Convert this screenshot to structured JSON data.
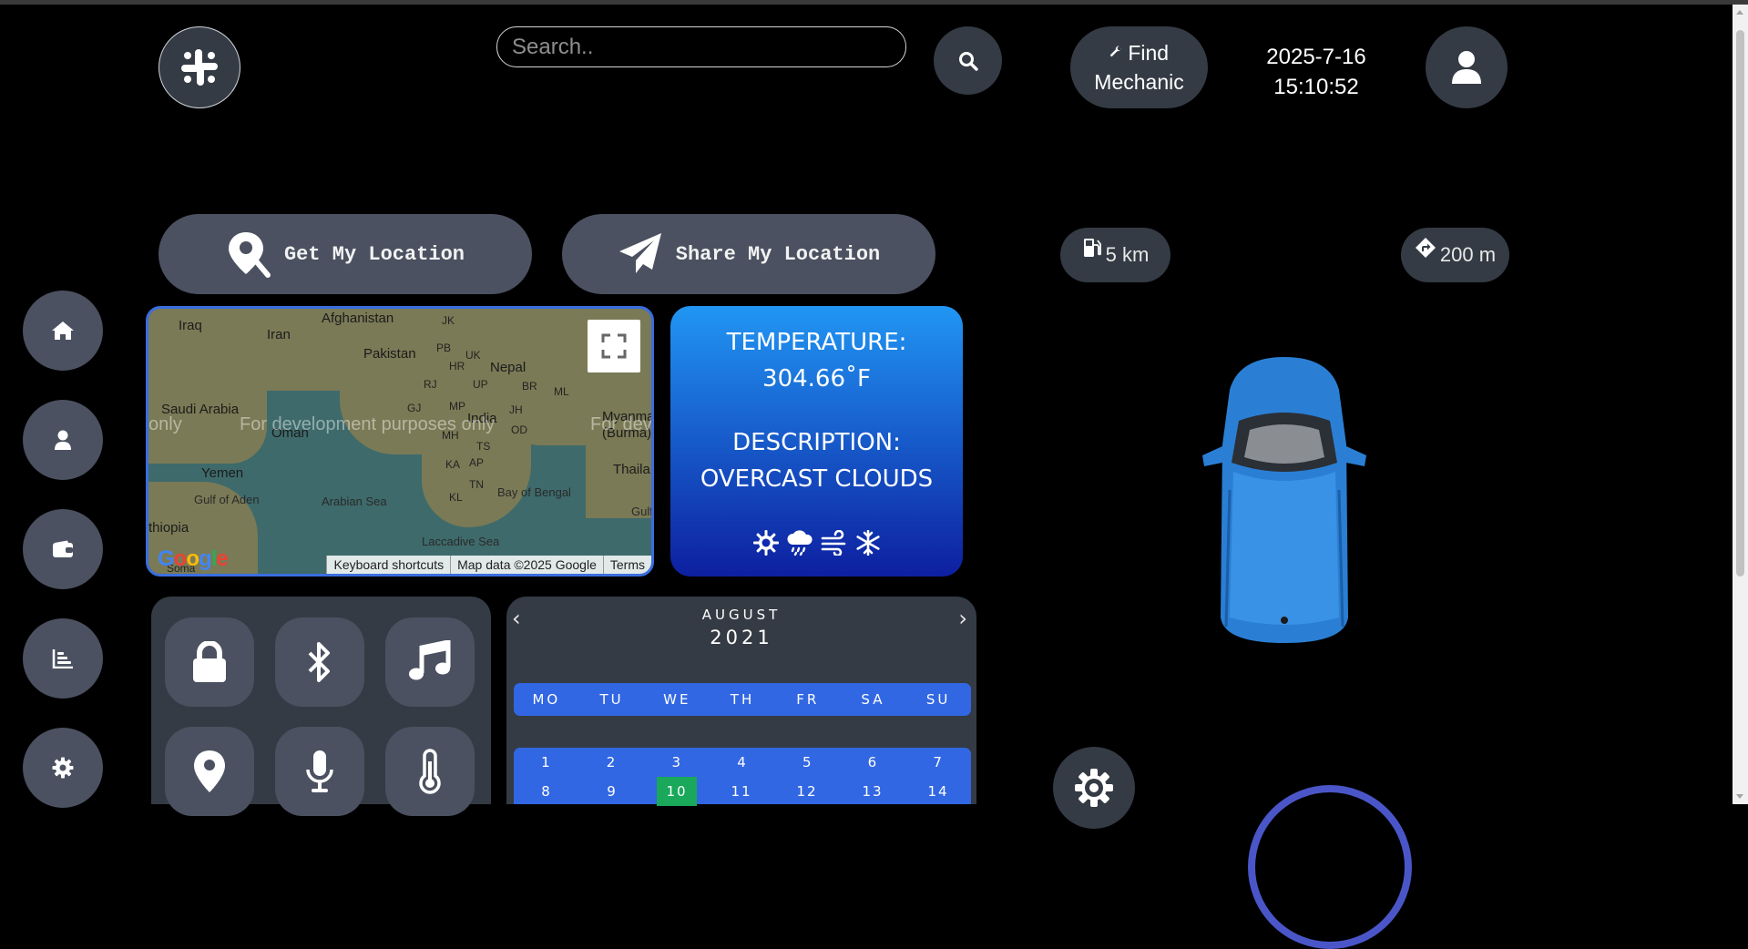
{
  "header": {
    "search_placeholder": "Search..",
    "find_mechanic_line1": "Find",
    "find_mechanic_line2": "Mechanic",
    "date": "2025-7-16",
    "time": "15:10:52"
  },
  "actions": {
    "get_location": "Get My Location",
    "share_location": "Share My Location"
  },
  "stats": {
    "fuel_range": "5 km",
    "next_turn": "200 m"
  },
  "sidebar": {
    "items": [
      {
        "icon": "home-icon"
      },
      {
        "icon": "user-icon"
      },
      {
        "icon": "wallet-icon"
      },
      {
        "icon": "chart-icon"
      },
      {
        "icon": "settings-icon"
      }
    ]
  },
  "map": {
    "labels": {
      "afghanistan": "Afghanistan",
      "iraq": "Iraq",
      "iran": "Iran",
      "pakistan": "Pakistan",
      "nepal": "Nepal",
      "saudi_arabia": "Saudi Arabia",
      "oman": "Oman",
      "india": "India",
      "myanmar": "Myanmar",
      "burma": "(Burma)",
      "thailand": "Thaila",
      "yemen": "Yemen",
      "gulf_of_aden": "Gulf of Aden",
      "arabian_sea": "Arabian Sea",
      "bay_of_bengal": "Bay of Bengal",
      "ethiopia": "thiopia",
      "laccadive_sea": "Laccadive Sea",
      "gulf": "Gulf",
      "somalia": "Soma",
      "jk": "JK",
      "pb": "PB",
      "uk": "UK",
      "hr": "HR",
      "rj": "RJ",
      "up": "UP",
      "br": "BR",
      "ml": "ML",
      "gj": "GJ",
      "mp": "MP",
      "jh": "JH",
      "mh": "MH",
      "od": "OD",
      "ts": "TS",
      "ka": "KA",
      "ap": "AP",
      "tn": "TN",
      "kl": "KL"
    },
    "watermark_left": "only",
    "watermark_center": "For development purposes only",
    "watermark_right": "For dev",
    "logo": "Google",
    "attribution": {
      "shortcuts": "Keyboard shortcuts",
      "data": "Map data ©2025 Google",
      "terms": "Terms"
    }
  },
  "weather": {
    "temperature_label": "TEMPERATURE:",
    "temperature_value": "304.66˚F",
    "description_label": "DESCRIPTION:",
    "description_value": "OVERCAST CLOUDS",
    "icons": [
      "sun-icon",
      "rain-cloud-icon",
      "wind-icon",
      "snowflake-icon"
    ]
  },
  "controls": {
    "items": [
      {
        "icon": "lock-icon"
      },
      {
        "icon": "bluetooth-icon"
      },
      {
        "icon": "music-icon"
      },
      {
        "icon": "location-pin-icon"
      },
      {
        "icon": "microphone-icon"
      },
      {
        "icon": "thermometer-icon"
      }
    ]
  },
  "calendar": {
    "prev": "‹",
    "next": "›",
    "month": "AUGUST",
    "year": "2021",
    "weekdays": [
      "MO",
      "TU",
      "WE",
      "TH",
      "FR",
      "SA",
      "SU"
    ],
    "week1": [
      "1",
      "2",
      "3",
      "4",
      "5",
      "6",
      "7"
    ],
    "week2": [
      "8",
      "9",
      "10",
      "11",
      "12",
      "13",
      "14"
    ],
    "today": "10"
  },
  "colors": {
    "panel": "#343b44",
    "button": "#4b5160",
    "accent_blue": "#3267e3",
    "today": "#1aa85b",
    "car": "#2a7fd4"
  }
}
